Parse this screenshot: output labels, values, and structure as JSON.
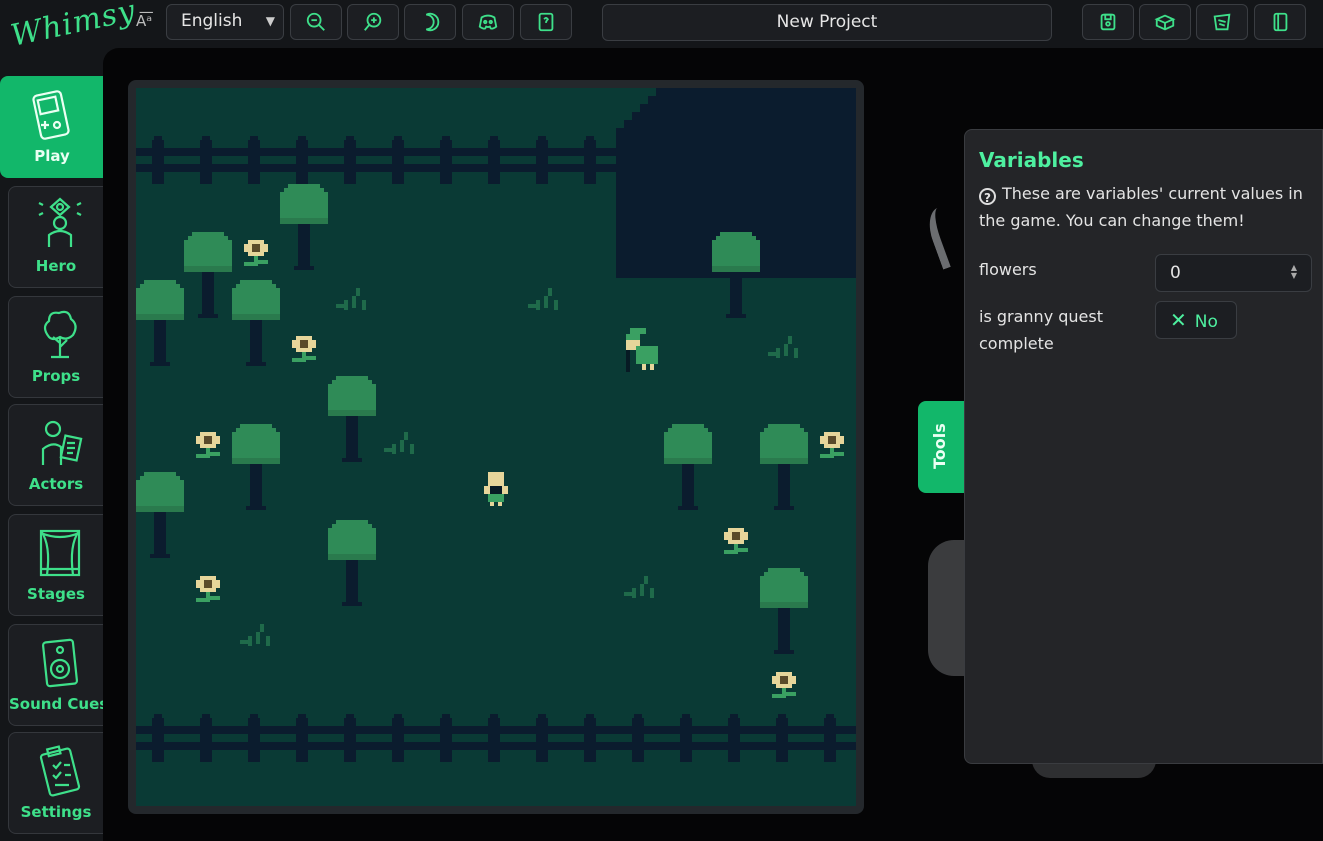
{
  "app": {
    "logo": "Whimsy"
  },
  "header": {
    "language": "English",
    "project_name": "New Project"
  },
  "toolbar_left": [
    {
      "name": "zoom-out-button",
      "icon": "zoom-out-icon"
    },
    {
      "name": "zoom-in-button",
      "icon": "zoom-in-icon"
    },
    {
      "name": "theme-button",
      "icon": "moon-icon"
    },
    {
      "name": "discord-button",
      "icon": "discord-icon"
    },
    {
      "name": "help-button",
      "icon": "book-icon"
    }
  ],
  "toolbar_right": [
    {
      "name": "save-button",
      "icon": "save-icon"
    },
    {
      "name": "export-button",
      "icon": "box-icon"
    },
    {
      "name": "open-button",
      "icon": "folder-icon"
    },
    {
      "name": "new-button",
      "icon": "file-icon"
    }
  ],
  "sidebar": {
    "items": [
      {
        "label": "Play",
        "icon": "gameboy-icon",
        "active": true
      },
      {
        "label": "Hero",
        "icon": "hero-icon"
      },
      {
        "label": "Props",
        "icon": "tree-icon"
      },
      {
        "label": "Actors",
        "icon": "actor-icon"
      },
      {
        "label": "Stages",
        "icon": "stage-icon"
      },
      {
        "label": "Sound Cues",
        "icon": "speaker-icon"
      },
      {
        "label": "Settings",
        "icon": "clipboard-icon"
      }
    ]
  },
  "tools_tab": {
    "label": "Tools"
  },
  "variables_panel": {
    "title": "Variables",
    "help_text": "These are variables' current values in the game. You can change them!",
    "variables": [
      {
        "label": "flowers",
        "type": "number",
        "value": "0"
      },
      {
        "label": "is granny quest complete",
        "type": "boolean",
        "value": "No"
      }
    ]
  },
  "colors": {
    "accent": "#12b76a",
    "accent_text": "#3ee08a",
    "game_bg": "#0a3a35",
    "game_dark": "#0b1c2e",
    "tree": "#2f8b57",
    "flower": "#e6d59a"
  }
}
